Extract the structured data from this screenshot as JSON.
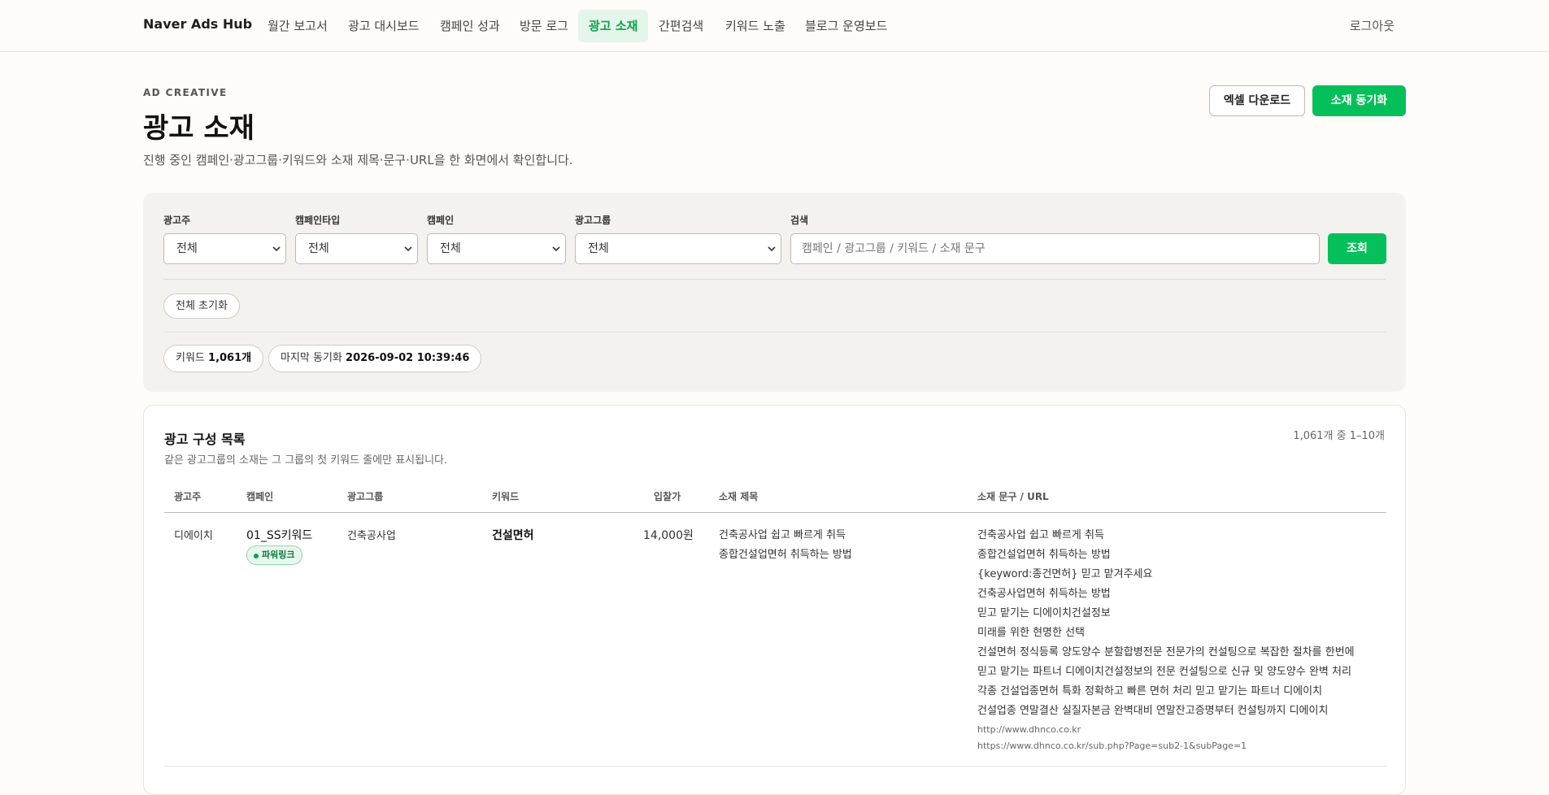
{
  "app": {
    "brand": "Naver Ads Hub"
  },
  "nav": {
    "items": [
      {
        "label": "월간 보고서"
      },
      {
        "label": "광고 대시보드"
      },
      {
        "label": "캠페인 성과"
      },
      {
        "label": "방문 로그"
      },
      {
        "label": "광고 소재",
        "active": true
      },
      {
        "label": "간편검색"
      },
      {
        "label": "키워드 노출"
      },
      {
        "label": "블로그 운영보드"
      }
    ],
    "logout": "로그아웃"
  },
  "header": {
    "eyebrow": "AD CREATIVE",
    "title": "광고 소재",
    "description": "진행 중인 캠페인·광고그룹·키워드와 소재 제목·문구·URL을 한 화면에서 확인합니다.",
    "excel_button": "엑셀 다운로드",
    "sync_button": "소재 동기화"
  },
  "filters": {
    "advertiser": {
      "label": "광고주",
      "value": "전체"
    },
    "campaign_type": {
      "label": "캠페인타입",
      "value": "전체"
    },
    "campaign": {
      "label": "캠페인",
      "value": "전체"
    },
    "ad_group": {
      "label": "광고그룹",
      "value": "전체"
    },
    "search": {
      "label": "검색",
      "placeholder": "캠페인 / 광고그룹 / 키워드 / 소재 문구"
    },
    "search_button": "조회",
    "reset_button": "전체 초기화",
    "keyword_count_label": "키워드",
    "keyword_count_value": "1,061개",
    "last_sync_label": "마지막 동기화",
    "last_sync_value": "2026-09-02 10:39:46"
  },
  "table": {
    "title": "광고 구성 목록",
    "subtitle": "같은 광고그룹의 소재는 그 그룹의 첫 키워드 줄에만 표시됩니다.",
    "count": "1,061개 중 1–10개",
    "columns": [
      "광고주",
      "캠페인",
      "광고그룹",
      "키워드",
      "입찰가",
      "소재 제목",
      "소재 문구 / URL"
    ],
    "rows": [
      {
        "advertiser": "디에이치",
        "campaign": "01_SS키워드",
        "campaign_badge": "파워링크",
        "ad_group": "건축공사업",
        "keyword": "건설면허",
        "bid": "14,000원",
        "titles": [
          "건축공사업 쉽고 빠르게 취득",
          "종합건설업면허 취득하는 방법"
        ],
        "copies": [
          "건축공사업 쉽고 빠르게 취득",
          "종합건설업면허 취득하는 방법",
          "{keyword:종건면허} 믿고 맡겨주세요",
          "건축공사업면허 취득하는 방법",
          "믿고 맡기는 디에이치건설정보",
          "미래를 위한 현명한 선택",
          "건설면허 정식등록 양도양수 분할합병전문 전문가의 컨설팅으로 복잡한 절차를 한번에",
          "믿고 맡기는 파트너 디에이치건설정보의 전문 컨설팅으로 신규 및 양도양수 완벽 처리",
          "각종 건설업종면허 특화 정확하고 빠른 면허 처리 믿고 맡기는 파트너 디에이치",
          "건설업종 연말결산 실질자본금 완벽대비 연말잔고증명부터 컨설팅까지 디에이치"
        ],
        "urls": [
          "http://www.dhnco.co.kr",
          "https://www.dhnco.co.kr/sub.php?Page=sub2-1&subPage=1"
        ]
      }
    ]
  },
  "colors": {
    "accent": "#05c05a",
    "active_tab_bg": "#e4f5ea",
    "page_bg": "#fdfcf8",
    "panel_bg": "#f4f2ee"
  },
  "icons": {
    "select": "chevron-down-icon",
    "badge": "dot-icon"
  }
}
